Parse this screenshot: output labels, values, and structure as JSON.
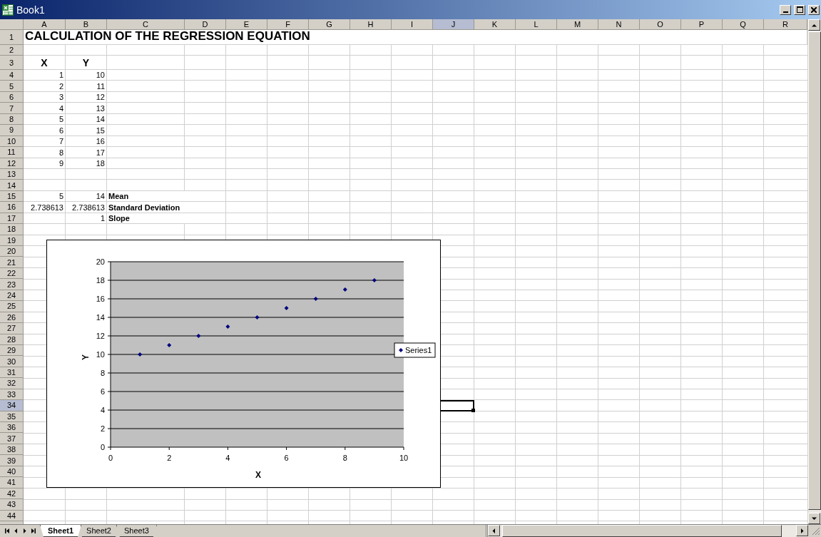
{
  "window": {
    "title": "Book1"
  },
  "columns": [
    {
      "label": "A",
      "selected": false
    },
    {
      "label": "B",
      "selected": false
    },
    {
      "label": "C",
      "selected": false
    },
    {
      "label": "D",
      "selected": false
    },
    {
      "label": "E",
      "selected": false
    },
    {
      "label": "F",
      "selected": false
    },
    {
      "label": "G",
      "selected": false
    },
    {
      "label": "H",
      "selected": false
    },
    {
      "label": "I",
      "selected": false
    },
    {
      "label": "J",
      "selected": true
    },
    {
      "label": "K",
      "selected": false
    },
    {
      "label": "L",
      "selected": false
    },
    {
      "label": "M",
      "selected": false
    },
    {
      "label": "N",
      "selected": false
    },
    {
      "label": "O",
      "selected": false
    },
    {
      "label": "P",
      "selected": false
    },
    {
      "label": "Q",
      "selected": false
    },
    {
      "label": "R",
      "selected": false
    }
  ],
  "rows": [
    {
      "number": "1",
      "selected": false,
      "cells": {
        "col_a": {
          "text": "CALCULATION OF THE REGRESSION EQUATION",
          "kind": "title"
        }
      }
    },
    {
      "number": "2",
      "selected": false
    },
    {
      "number": "3",
      "selected": false,
      "cells": {
        "col_a": {
          "text": "X",
          "kind": "heading"
        },
        "col_b": {
          "text": "Y",
          "kind": "heading"
        }
      }
    },
    {
      "number": "4",
      "selected": false,
      "cells": {
        "col_a": {
          "text": "1",
          "kind": "number"
        },
        "col_b": {
          "text": "10",
          "kind": "number"
        }
      }
    },
    {
      "number": "5",
      "selected": false,
      "cells": {
        "col_a": {
          "text": "2",
          "kind": "number"
        },
        "col_b": {
          "text": "11",
          "kind": "number"
        }
      }
    },
    {
      "number": "6",
      "selected": false,
      "cells": {
        "col_a": {
          "text": "3",
          "kind": "number"
        },
        "col_b": {
          "text": "12",
          "kind": "number"
        }
      }
    },
    {
      "number": "7",
      "selected": false,
      "cells": {
        "col_a": {
          "text": "4",
          "kind": "number"
        },
        "col_b": {
          "text": "13",
          "kind": "number"
        }
      }
    },
    {
      "number": "8",
      "selected": false,
      "cells": {
        "col_a": {
          "text": "5",
          "kind": "number"
        },
        "col_b": {
          "text": "14",
          "kind": "number"
        }
      }
    },
    {
      "number": "9",
      "selected": false,
      "cells": {
        "col_a": {
          "text": "6",
          "kind": "number"
        },
        "col_b": {
          "text": "15",
          "kind": "number"
        }
      }
    },
    {
      "number": "10",
      "selected": false,
      "cells": {
        "col_a": {
          "text": "7",
          "kind": "number"
        },
        "col_b": {
          "text": "16",
          "kind": "number"
        }
      }
    },
    {
      "number": "11",
      "selected": false,
      "cells": {
        "col_a": {
          "text": "8",
          "kind": "number"
        },
        "col_b": {
          "text": "17",
          "kind": "number"
        }
      }
    },
    {
      "number": "12",
      "selected": false,
      "cells": {
        "col_a": {
          "text": "9",
          "kind": "number"
        },
        "col_b": {
          "text": "18",
          "kind": "number"
        }
      }
    },
    {
      "number": "13",
      "selected": false
    },
    {
      "number": "14",
      "selected": false
    },
    {
      "number": "15",
      "selected": false,
      "cells": {
        "col_a": {
          "text": "5",
          "kind": "number"
        },
        "col_b": {
          "text": "14",
          "kind": "number"
        },
        "col_c": {
          "text": "Mean",
          "kind": "label"
        }
      }
    },
    {
      "number": "16",
      "selected": false,
      "cells": {
        "col_a": {
          "text": "2.738613",
          "kind": "number"
        },
        "col_b": {
          "text": "2.738613",
          "kind": "number"
        },
        "col_c": {
          "text": "Standard Deviation",
          "kind": "label"
        }
      }
    },
    {
      "number": "17",
      "selected": false,
      "cells": {
        "col_b": {
          "text": "1",
          "kind": "number"
        },
        "col_c": {
          "text": "Slope",
          "kind": "label"
        }
      }
    },
    {
      "number": "18",
      "selected": false
    },
    {
      "number": "19",
      "selected": false
    },
    {
      "number": "20",
      "selected": false
    },
    {
      "number": "21",
      "selected": false
    },
    {
      "number": "22",
      "selected": false
    },
    {
      "number": "23",
      "selected": false
    },
    {
      "number": "24",
      "selected": false
    },
    {
      "number": "25",
      "selected": false
    },
    {
      "number": "26",
      "selected": false
    },
    {
      "number": "27",
      "selected": false
    },
    {
      "number": "28",
      "selected": false
    },
    {
      "number": "29",
      "selected": false
    },
    {
      "number": "30",
      "selected": false
    },
    {
      "number": "31",
      "selected": false
    },
    {
      "number": "32",
      "selected": false
    },
    {
      "number": "33",
      "selected": false
    },
    {
      "number": "34",
      "selected": true
    },
    {
      "number": "35",
      "selected": false
    },
    {
      "number": "36",
      "selected": false
    },
    {
      "number": "37",
      "selected": false
    },
    {
      "number": "38",
      "selected": false
    },
    {
      "number": "39",
      "selected": false
    },
    {
      "number": "40",
      "selected": false
    },
    {
      "number": "41",
      "selected": false
    },
    {
      "number": "42",
      "selected": false
    },
    {
      "number": "43",
      "selected": false
    },
    {
      "number": "44",
      "selected": false
    }
  ],
  "chart": {
    "chart_data": {
      "type": "scatter",
      "xlabel": "X",
      "ylabel": "Y",
      "x": [
        1,
        2,
        3,
        4,
        5,
        6,
        7,
        8,
        9
      ],
      "series": [
        {
          "name": "Series1",
          "color": "#000080",
          "values": [
            10,
            11,
            12,
            13,
            14,
            15,
            16,
            17,
            18
          ]
        }
      ],
      "xlim": [
        0,
        10
      ],
      "ylim": [
        0,
        20
      ],
      "grid": true,
      "xticks": [
        0,
        2,
        4,
        6,
        8,
        10
      ],
      "yticks": [
        0,
        2,
        4,
        6,
        8,
        10,
        12,
        14,
        16,
        18,
        20
      ]
    }
  },
  "sheet_tabs": [
    {
      "label": "Sheet1",
      "selected": true
    },
    {
      "label": "Sheet2",
      "selected": false
    },
    {
      "label": "Sheet3",
      "selected": false
    }
  ]
}
